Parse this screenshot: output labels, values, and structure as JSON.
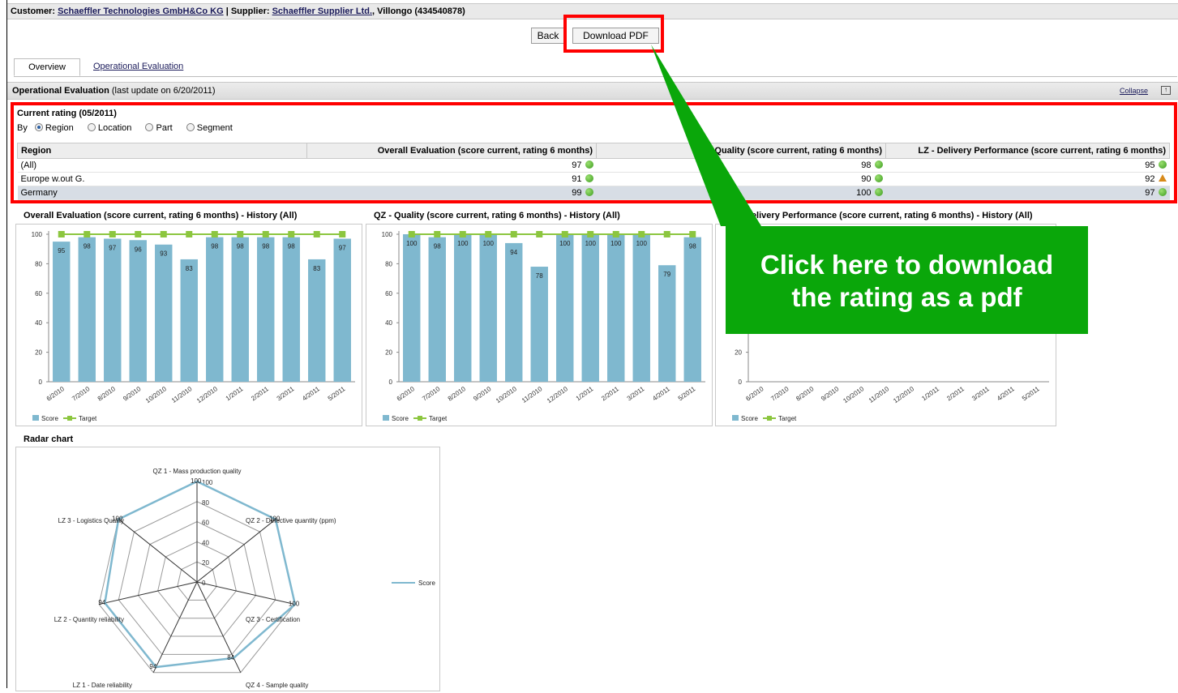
{
  "header": {
    "customer_label": "Customer:",
    "customer_name": "Schaeffler Technologies GmbH&Co KG",
    "separator": "|",
    "supplier_label": "Supplier:",
    "supplier_name": "Schaeffler Supplier Ltd.",
    "supplier_suffix": ", Villongo (434540878)"
  },
  "toolbar": {
    "back_label": "Back",
    "download_label": "Download PDF"
  },
  "tabs": [
    {
      "label": "Overview"
    },
    {
      "label": "Operational Evaluation"
    }
  ],
  "section": {
    "title": "Operational Evaluation",
    "subtitle": "(last update on 6/20/2011)",
    "collapse_label": "Collapse"
  },
  "current_rating": {
    "title": "Current rating (05/2011)",
    "by_label": "By",
    "options": [
      "Region",
      "Location",
      "Part",
      "Segment"
    ],
    "selected": "Region",
    "columns": [
      "Region",
      "Overall Evaluation (score current, rating 6 months)",
      "QZ - Quality (score current, rating 6 months)",
      "LZ - Delivery Performance (score current, rating 6 months)"
    ],
    "rows": [
      {
        "region": "(All)",
        "overall": "97",
        "quality": "98",
        "delivery": "95",
        "delivery_status": "green"
      },
      {
        "region": "Europe w.out G.",
        "overall": "91",
        "quality": "90",
        "delivery": "92",
        "delivery_status": "warning"
      },
      {
        "region": "Germany",
        "overall": "99",
        "quality": "100",
        "delivery": "97",
        "delivery_status": "green"
      }
    ]
  },
  "colors": {
    "bar": "#7fb8cf",
    "target": "#8cc63f",
    "highlight": "#ff0000",
    "callout": "#0aa70a"
  },
  "callout": {
    "line1": "Click here to download",
    "line2": "the rating as a pdf"
  },
  "radar_title": "Radar chart",
  "chart_data": [
    {
      "type": "bar",
      "title": "Overall Evaluation (score current, rating 6 months) - History (All)",
      "categories": [
        "6/2010",
        "7/2010",
        "8/2010",
        "9/2010",
        "10/2010",
        "11/2010",
        "12/2010",
        "1/2011",
        "2/2011",
        "3/2011",
        "4/2011",
        "5/2011"
      ],
      "series": [
        {
          "name": "Score",
          "values": [
            95,
            98,
            97,
            96,
            93,
            83,
            98,
            98,
            98,
            98,
            83,
            97
          ]
        },
        {
          "name": "Target",
          "values": [
            100,
            100,
            100,
            100,
            100,
            100,
            100,
            100,
            100,
            100,
            100,
            100
          ]
        }
      ],
      "ylim": [
        0,
        100
      ],
      "yticks": [
        0,
        20,
        40,
        60,
        80,
        100
      ],
      "show_labels": true,
      "legend": "bottom-left"
    },
    {
      "type": "bar",
      "title": "QZ - Quality (score current, rating 6 months) - History (All)",
      "categories": [
        "6/2010",
        "7/2010",
        "8/2010",
        "9/2010",
        "10/2010",
        "11/2010",
        "12/2010",
        "1/2011",
        "2/2011",
        "3/2011",
        "4/2011",
        "5/2011"
      ],
      "series": [
        {
          "name": "Score",
          "values": [
            100,
            98,
            100,
            100,
            94,
            78,
            100,
            100,
            100,
            100,
            79,
            98
          ]
        },
        {
          "name": "Target",
          "values": [
            100,
            100,
            100,
            100,
            100,
            100,
            100,
            100,
            100,
            100,
            100,
            100
          ]
        }
      ],
      "ylim": [
        0,
        100
      ],
      "yticks": [
        0,
        20,
        40,
        60,
        80,
        100
      ],
      "show_labels": true,
      "legend": "bottom-left"
    },
    {
      "type": "bar",
      "title": "Delivery Performance (score current, rating 6 months) - History (All)",
      "categories": [
        "6/2010",
        "7/2010",
        "8/2010",
        "9/2010",
        "10/2010",
        "11/2010",
        "12/2010",
        "1/2011",
        "2/2011",
        "3/2011",
        "4/2011",
        "5/2011"
      ],
      "series": [
        {
          "name": "Score",
          "values": [
            null,
            null,
            null,
            null,
            null,
            null,
            null,
            null,
            null,
            null,
            null,
            null
          ]
        },
        {
          "name": "Target",
          "values": [
            null,
            null,
            null,
            null,
            null,
            null,
            null,
            null,
            null,
            null,
            null,
            null
          ]
        }
      ],
      "ylim": [
        0,
        100
      ],
      "yticks": [
        0,
        20
      ],
      "show_labels": false,
      "legend": "bottom-left"
    },
    {
      "type": "radar",
      "title": "Radar chart",
      "axes": [
        "QZ 1 - Mass production quality",
        "QZ 2 - Defective quantity (ppm)",
        "QZ 3 - Certification",
        "QZ 4 - Sample quality",
        "LZ 1 - Date reliability",
        "LZ 2 - Quantity reliability",
        "LZ 3 - Logistics Quality"
      ],
      "series": [
        {
          "name": "Score",
          "values": [
            100,
            100,
            100,
            84,
            94,
            94,
            100
          ]
        }
      ],
      "rlim": [
        0,
        100
      ],
      "rticks": [
        0,
        20,
        40,
        60,
        80,
        100
      ],
      "legend": "right"
    }
  ]
}
